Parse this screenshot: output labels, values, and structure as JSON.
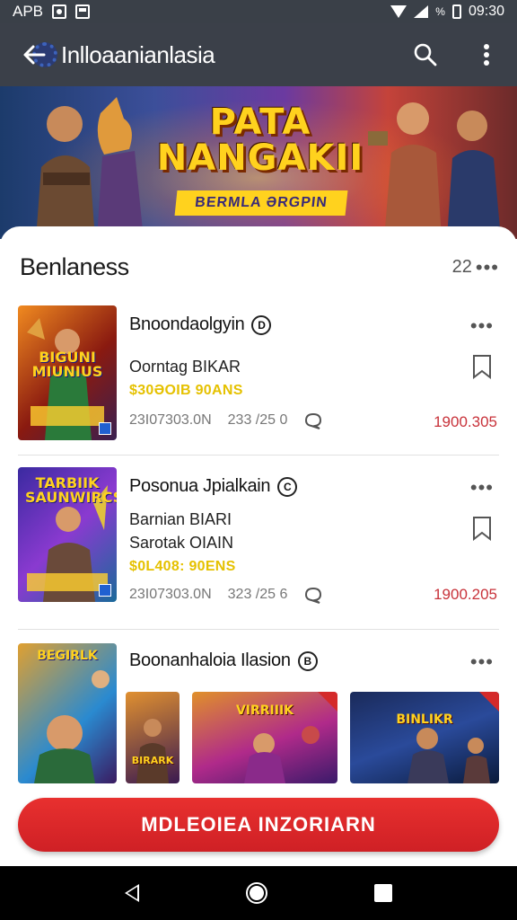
{
  "status_bar": {
    "carrier": "APB",
    "time": "09:30",
    "battery_pct": "%"
  },
  "app_bar": {
    "title": "Inlloaanianlasia"
  },
  "banner": {
    "title": "PATA NANGAKII",
    "subtitle": "BERMLA ƏRGPIN"
  },
  "section": {
    "title": "Benlaness",
    "count": "22"
  },
  "games": [
    {
      "thumb_title": "BIGUNI MIUNIUS",
      "title": "Bnoondaolgyin",
      "info": "D",
      "line1": "Oorntag BIKAR",
      "line2": "",
      "price": "$30ƏOIB 90ANS",
      "price_color": "#e5c100",
      "meta1": "23I07303.0N",
      "meta2": "233 /25 0",
      "amount": "1900.305"
    },
    {
      "thumb_title": "TARBIIK SAUNWIRCS",
      "title": "Posonua Jpialkain",
      "info": "C",
      "line1": "Barnian BIARI",
      "line2": "Sarotak OIAIN",
      "price": "$0L408: 90ENS",
      "price_color": "#e5c100",
      "meta1": "23I07303.0N",
      "meta2": "323 /25 6",
      "amount": "1900.205"
    }
  ],
  "third_game": {
    "title": "Boonanhaloia Ilasion",
    "info": "B",
    "thumbs": [
      "BEGIRLK",
      "BIRARK",
      "VIRRIIIK",
      "BINLIKR"
    ]
  },
  "cta": {
    "label": "MDLEOIEA INZORIARN"
  },
  "colors": {
    "accent": "#d9272d",
    "appbar": "#3b4049",
    "price": "#e5c100",
    "amount": "#c8323a"
  }
}
